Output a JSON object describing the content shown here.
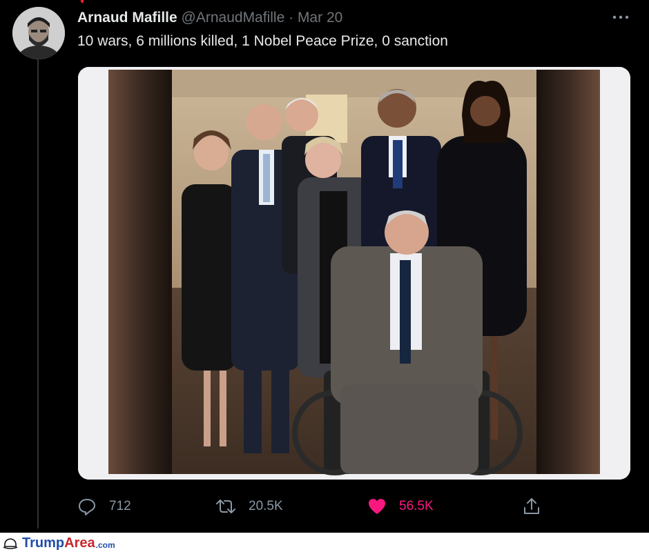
{
  "tweet": {
    "author_name": "Arnaud Mafille",
    "handle": "@ArnaudMafille",
    "separator": "·",
    "date": "Mar 20",
    "text": "10 wars, 6 millions killed, 1 Nobel Peace Prize, 0 sanction"
  },
  "actions": {
    "reply_count": "712",
    "retweet_count": "20.5K",
    "like_count": "56.5K"
  },
  "icons": {
    "more": "more-icon",
    "reply": "reply-icon",
    "retweet": "retweet-icon",
    "like": "heart-icon",
    "share": "share-icon",
    "watermark": "hat-icon"
  },
  "watermark": {
    "brand_part1": "Trump",
    "brand_part2": "Area",
    "suffix": ".com"
  },
  "colors": {
    "background": "#000000",
    "text_primary": "#e7e9ea",
    "text_secondary": "#71767b",
    "like_active": "#f91880",
    "watermark_blue": "#1f4ea8",
    "watermark_red": "#c9272d"
  }
}
